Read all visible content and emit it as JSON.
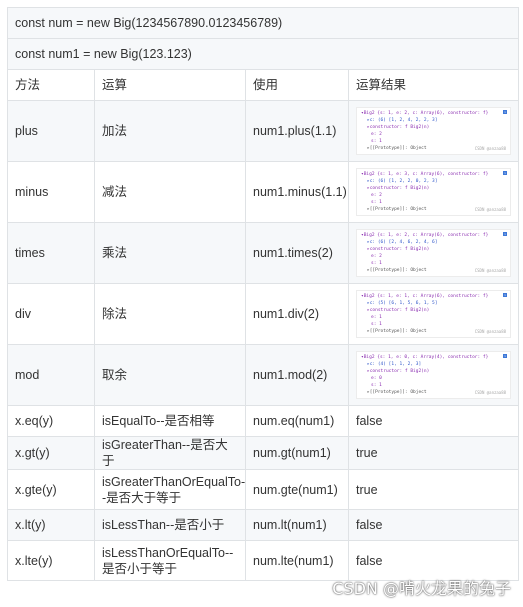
{
  "rows_top": [
    "const num = new Big(1234567890.0123456789)",
    "const num1 = new Big(123.123)"
  ],
  "headers": [
    "方法",
    "运算",
    "使用",
    "运算结果"
  ],
  "arith_rows": [
    {
      "method": "plus",
      "op": "加法",
      "usage": "num1.plus(1.1)",
      "shot": [
        "▾Big2 {s: 1, e: 2, c: Array(6), constructor: f}",
        "▸c: (6) [1, 2, 4, 2, 2, 3]",
        "▸constructor: f Big2(n)",
        "e: 2",
        "s: 1",
        "▸[[Prototype]]: Object"
      ]
    },
    {
      "method": "minus",
      "op": "减法",
      "usage": "num1.minus(1.1)",
      "shot": [
        "▾Big2 {s: 1, e: 3, c: Array(6), constructor: f}",
        "▸c: (6) [1, 2, 2, 0, 2, 3]",
        "▸constructor: f Big2(n)",
        "e: 2",
        "s: 1",
        "▸[[Prototype]]: Object"
      ]
    },
    {
      "method": "times",
      "op": "乘法",
      "usage": "num1.times(2)",
      "shot": [
        "▾Big2 {s: 1, e: 2, c: Array(6), constructor: f}",
        "▸c: (6) [2, 4, 6, 2, 4, 6]",
        "▸constructor: f Big2(n)",
        "e: 2",
        "s: 1",
        "▸[[Prototype]]: Object"
      ]
    },
    {
      "method": "div",
      "op": "除法",
      "usage": "num1.div(2)",
      "shot": [
        "▾Big2 {s: 1, e: 1, c: Array(6), constructor: f}",
        "▸c: (5) [6, 1, 5, 6, 1, 5]",
        "▸constructor: f Big2(n)",
        "e: 1",
        "s: 1",
        "▸[[Prototype]]: Object"
      ]
    },
    {
      "method": "mod",
      "op": "取余",
      "usage": "num1.mod(2)",
      "shot": [
        "▾Big2 {s: 1, e: 0, c: Array(4), constructor: f}",
        "▸c: (4) [1, 1, 2, 3]",
        "▸constructor: f Big2(n)",
        "e: 0",
        "s: 1",
        "▸[[Prototype]]: Object"
      ]
    }
  ],
  "shot_watermark": "CSDN @anzaa88",
  "compare_rows": [
    {
      "method": "x.eq(y)",
      "op": "isEqualTo--是否相等",
      "usage": "num.eq(num1)",
      "result": "false"
    },
    {
      "method": "x.gt(y)",
      "op": "isGreaterThan--是否大于",
      "usage": "num.gt(num1)",
      "result": "true"
    },
    {
      "method": "x.gte(y)",
      "op": "isGreaterThanOrEqualTo--是否大于等于",
      "usage": "num.gte(num1)",
      "result": "true"
    },
    {
      "method": "x.lt(y)",
      "op": "isLessThan--是否小于",
      "usage": "num.lt(num1)",
      "result": "false"
    },
    {
      "method": "x.lte(y)",
      "op": "isLessThanOrEqualTo--是否小于等于",
      "usage": "num.lte(num1)",
      "result": "false"
    }
  ],
  "watermark": "CSDN @啃火龙果的兔子"
}
